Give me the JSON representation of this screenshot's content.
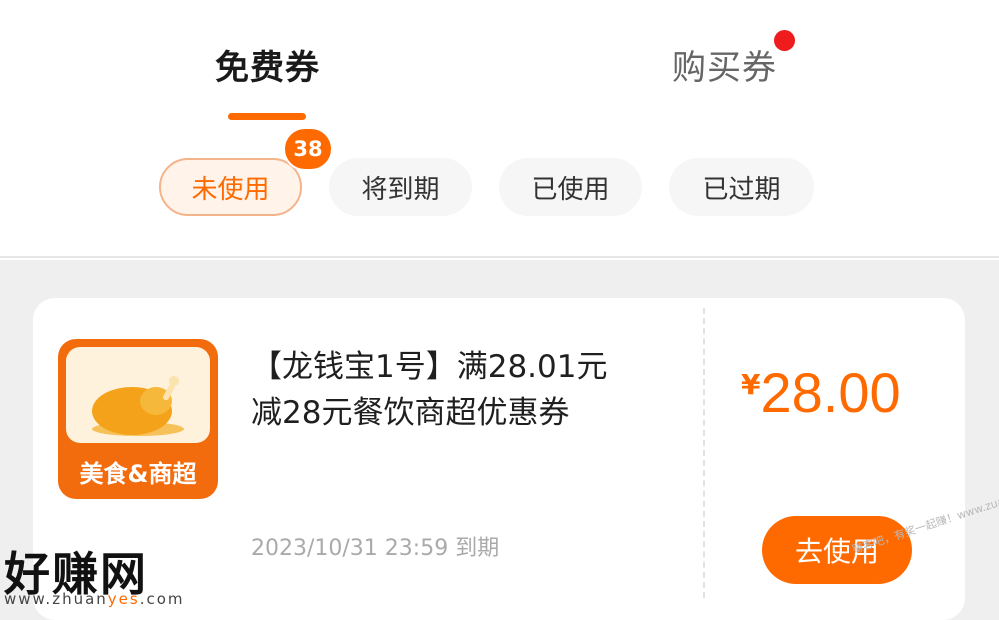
{
  "tabs": {
    "free_label": "免费券",
    "buy_label": "购买券"
  },
  "filters": {
    "unused": "未使用",
    "expiring": "将到期",
    "used": "已使用",
    "expired": "已过期",
    "unused_count": "38"
  },
  "coupon": {
    "thumb_label": "美食&商超",
    "title_line1": "【龙钱宝1号】满28.01元",
    "title_line2": "减28元餐饮商超优惠券",
    "currency": "¥",
    "amount": "28.00",
    "expiry": "2023/10/31 23:59 到期",
    "use_button": "去使用"
  },
  "watermark": {
    "logo": "好赚网",
    "url_prefix": "www.zhuan",
    "url_highlight": "yes",
    "url_suffix": ".com",
    "slogan": "赚客吧，有奖一起赚！www.zuanke8.com"
  },
  "colors": {
    "accent": "#ff6a00",
    "notification_dot": "#ee1c1c"
  }
}
